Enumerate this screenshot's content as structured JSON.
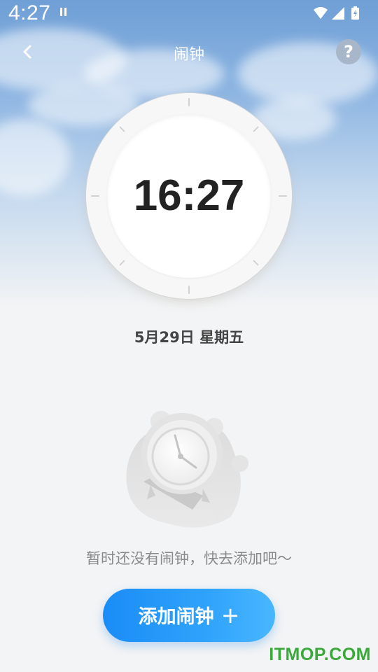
{
  "status_bar": {
    "time": "4:27",
    "icons": [
      "wifi-icon",
      "signal-icon",
      "battery-charging-icon"
    ]
  },
  "navbar": {
    "title": "闹钟",
    "back_icon": "chevron-left-icon",
    "help_label": "?"
  },
  "clock": {
    "time": "16:27"
  },
  "date": "5月29日 星期五",
  "empty_state": {
    "illustration": "alarm-clock-illustration",
    "message": "暂时还没有闹钟，快去添加吧～"
  },
  "add_button": {
    "label": "添加闹钟",
    "icon": "+"
  },
  "watermark": "ITMOP.COM",
  "colors": {
    "accent": "#1a8cf7",
    "accent_light": "#49b6ff",
    "sky_top": "#6f9fd6",
    "background": "#f3f4f5",
    "watermark": "#3aa93a"
  }
}
